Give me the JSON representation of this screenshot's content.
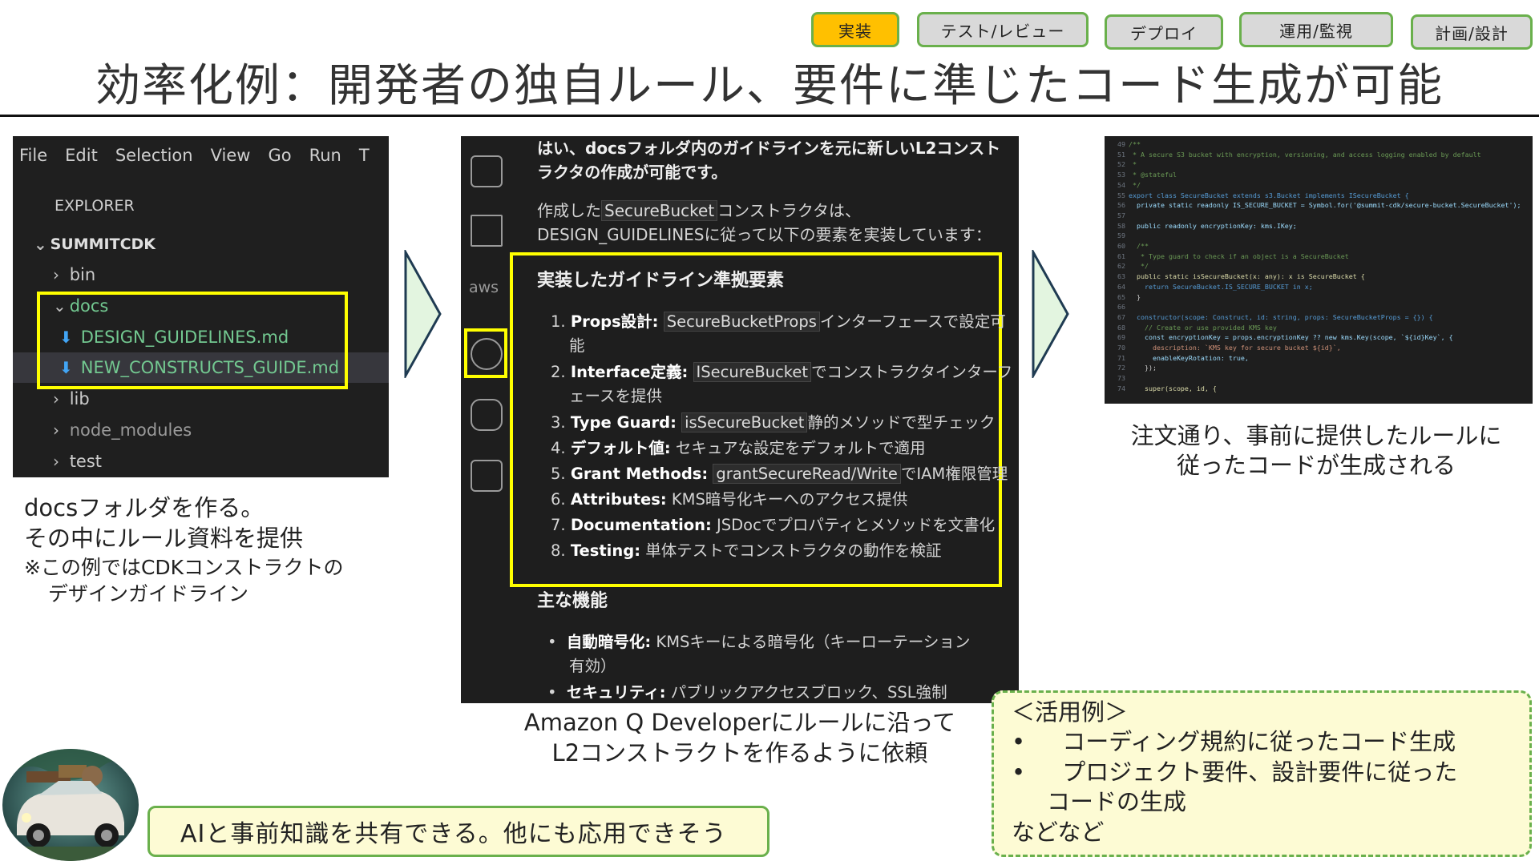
{
  "tabs": [
    "実装",
    "テスト/レビュー",
    "デプロイ",
    "運用/監視",
    "計画/設計"
  ],
  "title": "効率化例：開発者の独自ルール、要件に準じたコード生成が可能",
  "explorer": {
    "menu": [
      "File",
      "Edit",
      "Selection",
      "View",
      "Go",
      "Run",
      "T"
    ],
    "header": "EXPLORER",
    "root": "SUMMITCDK",
    "items": [
      "bin",
      "docs",
      "DESIGN_GUIDELINES.md",
      "NEW_CONSTRUCTS_GUIDE.md",
      "lib",
      "node_modules",
      "test"
    ]
  },
  "caption1": {
    "line1": "docsフォルダを作る。",
    "line2": "その中にルール資料を提供",
    "note1": "※この例ではCDKコンストラクトの",
    "note2": "デザインガイドライン"
  },
  "chat": {
    "intro1": "はい、docsフォルダ内のガイドラインを元に新しいL2コンスト",
    "intro2": "ラクタの作成が可能です。",
    "made_prefix": "作成した",
    "made_code": "SecureBucket",
    "made_suffix": "コンストラクタは、",
    "made2": "DESIGN_GUIDELINESに従って以下の要素を実装しています：",
    "section1": "実装したガイドライン準拠要素",
    "items": [
      {
        "num": "1.",
        "bold": "Props設計:",
        "code": "SecureBucketProps",
        "text": "インターフェースで設定可",
        "cont": "能"
      },
      {
        "num": "2.",
        "bold": "Interface定義:",
        "code": "ISecureBucket",
        "text": "でコンストラクタインターフ",
        "cont": "ェースを提供"
      },
      {
        "num": "3.",
        "bold": "Type Guard:",
        "code": "isSecureBucket",
        "text": "静的メソッドで型チェック"
      },
      {
        "num": "4.",
        "bold": "デフォルト値:",
        "text": "セキュアな設定をデフォルトで適用"
      },
      {
        "num": "5.",
        "bold": "Grant Methods:",
        "code": "grantSecureRead/Write",
        "text": "でIAM権限管理"
      },
      {
        "num": "6.",
        "bold": "Attributes:",
        "text": "KMS暗号化キーへのアクセス提供"
      },
      {
        "num": "7.",
        "bold": "Documentation:",
        "text": "JSDocでプロパティとメソッドを文書化"
      },
      {
        "num": "8.",
        "bold": "Testing:",
        "text": "単体テストでコンストラクタの動作を検証"
      }
    ],
    "section2": "主な機能",
    "features": [
      {
        "bold": "自動暗号化:",
        "text": "KMSキーによる暗号化（キーローテーション",
        "cont": "有効）"
      },
      {
        "bold": "セキュリティ:",
        "text": "パブリックアクセスブロック、SSL強制"
      }
    ]
  },
  "caption2": {
    "line1": "Amazon Q Developerにルールに沿って",
    "line2": "L2コンストラクトを作るように依頼"
  },
  "code": {
    "lines": [
      {
        "n": "49",
        "t": "/**",
        "cls": "c"
      },
      {
        "n": "51",
        "t": " * A secure S3 bucket with encryption, versioning, and access logging enabled by default",
        "cls": "c"
      },
      {
        "n": "52",
        "t": " *",
        "cls": "c"
      },
      {
        "n": "53",
        "t": " * @stateful",
        "cls": "c"
      },
      {
        "n": "54",
        "t": " */",
        "cls": "c"
      },
      {
        "n": "55",
        "t": "export class SecureBucket extends s3.Bucket implements ISecureBucket {",
        "cls": "k"
      },
      {
        "n": "56",
        "t": "  private static readonly IS_SECURE_BUCKET = Symbol.for('@summit-cdk/secure-bucket.SecureBucket');",
        "cls": "v"
      },
      {
        "n": "57",
        "t": "",
        "cls": "w"
      },
      {
        "n": "58",
        "t": "  public readonly encryptionKey: kms.IKey;",
        "cls": "v"
      },
      {
        "n": "59",
        "t": "",
        "cls": "w"
      },
      {
        "n": "60",
        "t": "  /**",
        "cls": "c"
      },
      {
        "n": "61",
        "t": "   * Type guard to check if an object is a SecureBucket",
        "cls": "c"
      },
      {
        "n": "62",
        "t": "   */",
        "cls": "c"
      },
      {
        "n": "63",
        "t": "  public static isSecureBucket(x: any): x is SecureBucket {",
        "cls": "f"
      },
      {
        "n": "64",
        "t": "    return SecureBucket.IS_SECURE_BUCKET in x;",
        "cls": "k"
      },
      {
        "n": "65",
        "t": "  }",
        "cls": "w"
      },
      {
        "n": "66",
        "t": "",
        "cls": "w"
      },
      {
        "n": "67",
        "t": "  constructor(scope: Construct, id: string, props: SecureBucketProps = {}) {",
        "cls": "k"
      },
      {
        "n": "68",
        "t": "    // Create or use provided KMS key",
        "cls": "c"
      },
      {
        "n": "69",
        "t": "    const encryptionKey = props.encryptionKey ?? new kms.Key(scope, `${id}Key`, {",
        "cls": "v"
      },
      {
        "n": "70",
        "t": "      description: `KMS key for secure bucket ${id}`,",
        "cls": "s"
      },
      {
        "n": "71",
        "t": "      enableKeyRotation: true,",
        "cls": "v"
      },
      {
        "n": "72",
        "t": "    });",
        "cls": "w"
      },
      {
        "n": "73",
        "t": "",
        "cls": "w"
      },
      {
        "n": "74",
        "t": "    super(scope, id, {",
        "cls": "f"
      }
    ]
  },
  "caption3": {
    "line1": "注文通り、事前に提供したルールに",
    "line2": "従ったコードが生成される"
  },
  "usage": {
    "title": "＜活用例＞",
    "bullets": [
      "コーディング規約に従ったコード生成",
      "プロジェクト要件、設計要件に従った"
    ],
    "cont": "コードの生成",
    "footer": "などなど"
  },
  "bubble": "AIと事前知識を共有できる。他にも応用できそう",
  "colors": {
    "accent": "#ffc000",
    "frame": "#6ab04c",
    "highlight": "#ffff00",
    "note_bg": "#fdfbd4"
  }
}
